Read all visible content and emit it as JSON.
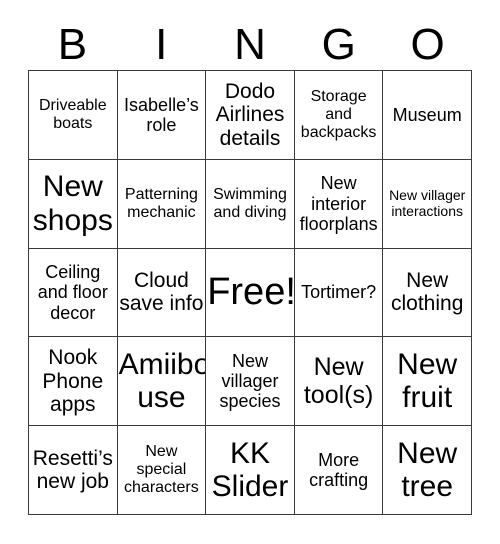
{
  "card": {
    "header_letters": [
      "B",
      "I",
      "N",
      "G",
      "O"
    ],
    "grid_size": 5,
    "text_color": "#000000",
    "border_color": "#3a3a3a",
    "background_color": "#ffffff",
    "rows": [
      [
        {
          "label": "Driveable boats",
          "size": "sm",
          "marked": false
        },
        {
          "label": "Isabelle’s role",
          "size": "md",
          "marked": false
        },
        {
          "label": "Dodo Airlines details",
          "size": "lg",
          "marked": false
        },
        {
          "label": "Storage and backpacks",
          "size": "sm",
          "marked": false
        },
        {
          "label": "Museum",
          "size": "md",
          "marked": false
        }
      ],
      [
        {
          "label": "New shops",
          "size": "xxl",
          "marked": false
        },
        {
          "label": "Patterning mechanic",
          "size": "sm",
          "marked": false
        },
        {
          "label": "Swimming and diving",
          "size": "sm",
          "marked": false
        },
        {
          "label": "New interior floorplans",
          "size": "md",
          "marked": false
        },
        {
          "label": "New villager interactions",
          "size": "xs",
          "marked": false
        }
      ],
      [
        {
          "label": "Ceiling and floor decor",
          "size": "md",
          "marked": false
        },
        {
          "label": "Cloud save info",
          "size": "lg",
          "marked": false
        },
        {
          "label": "Free!",
          "size": "huge",
          "marked": false
        },
        {
          "label": "Tortimer?",
          "size": "md",
          "marked": false
        },
        {
          "label": "New clothing",
          "size": "lg",
          "marked": false
        }
      ],
      [
        {
          "label": "Nook Phone apps",
          "size": "lg",
          "marked": false
        },
        {
          "label": "Amiibo use",
          "size": "xxl",
          "marked": false
        },
        {
          "label": "New villager species",
          "size": "md",
          "marked": false
        },
        {
          "label": "New tool(s)",
          "size": "xl",
          "marked": false
        },
        {
          "label": "New fruit",
          "size": "xxl",
          "marked": false
        }
      ],
      [
        {
          "label": "Resetti’s new job",
          "size": "lg",
          "marked": false
        },
        {
          "label": "New special characters",
          "size": "sm",
          "marked": false
        },
        {
          "label": "KK Slider",
          "size": "xxl",
          "marked": false
        },
        {
          "label": "More crafting",
          "size": "md",
          "marked": false
        },
        {
          "label": "New tree",
          "size": "xxl",
          "marked": false
        }
      ]
    ]
  }
}
